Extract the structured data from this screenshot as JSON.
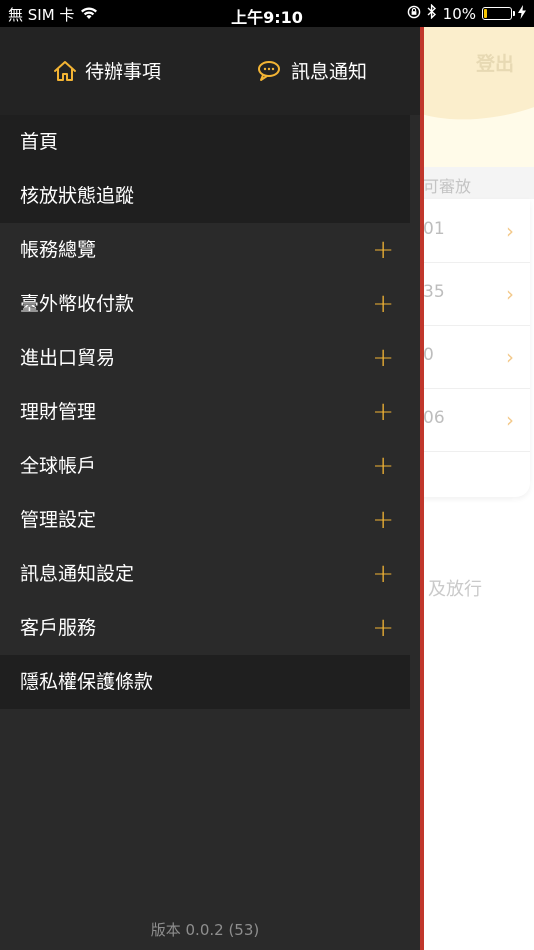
{
  "status_bar": {
    "carrier": "無 SIM 卡",
    "time": "上午9:10",
    "battery_percent": "10%",
    "battery_level": 0.1,
    "icons": [
      "wifi-icon",
      "orientation-lock-icon",
      "bluetooth-icon",
      "battery-icon",
      "charging-icon"
    ]
  },
  "drawer": {
    "top_buttons": {
      "todo": {
        "label": "待辦事項",
        "icon": "home-icon"
      },
      "messages": {
        "label": "訊息通知",
        "icon": "chat-bubble-icon"
      }
    },
    "menu": [
      {
        "label": "首頁",
        "expandable": false
      },
      {
        "label": "核放狀態追蹤",
        "expandable": false
      },
      {
        "label": "帳務總覽",
        "expandable": true
      },
      {
        "label": "臺外幣收付款",
        "expandable": true
      },
      {
        "label": "進出口貿易",
        "expandable": true
      },
      {
        "label": "理財管理",
        "expandable": true
      },
      {
        "label": "全球帳戶",
        "expandable": true
      },
      {
        "label": "管理設定",
        "expandable": true
      },
      {
        "label": "訊息通知設定",
        "expandable": true
      },
      {
        "label": "客戶服務",
        "expandable": true
      },
      {
        "label": "隱私權保護條款",
        "expandable": false
      }
    ],
    "expand_symbol": "+",
    "version": "版本 0.0.2 (53)"
  },
  "background_page": {
    "logout_label": "登出",
    "section_label": "可審放",
    "rows": [
      {
        "value": "01",
        "chevron": "›"
      },
      {
        "value": "35",
        "chevron": "›"
      },
      {
        "value": "0",
        "chevron": "›"
      },
      {
        "value": "06",
        "chevron": "›"
      }
    ],
    "footer_text": "及放行"
  },
  "colors": {
    "drawer_bg": "#2a2a2a",
    "drawer_top_bg": "#232323",
    "accent": "#f3b434",
    "drawer_edge": "#c0362b"
  }
}
